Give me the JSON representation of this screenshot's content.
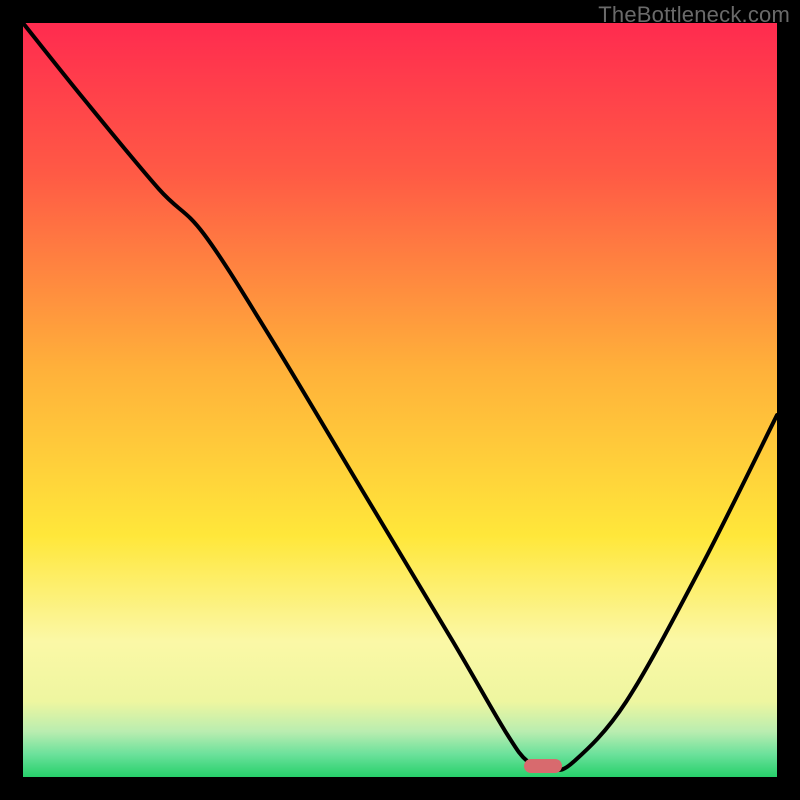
{
  "watermark": "TheBottleneck.com",
  "colors": {
    "frame": "#000000",
    "top": "#ff2b4f",
    "mid_orange": "#ff8a3a",
    "yellow": "#ffe93a",
    "pale_yellow": "#faf9b8",
    "mint": "#8ceab1",
    "green": "#26d06a",
    "curve": "#000000",
    "marker": "#d86a6e"
  },
  "chart_data": {
    "type": "line",
    "title": "",
    "xlabel": "",
    "ylabel": "",
    "xlim": [
      0,
      100
    ],
    "ylim": [
      0,
      100
    ],
    "series": [
      {
        "name": "bottleneck-curve",
        "x": [
          0,
          8,
          18,
          24,
          33,
          45,
          57,
          64,
          67,
          70,
          73,
          80,
          90,
          100
        ],
        "y": [
          100,
          90,
          78,
          72,
          58,
          38,
          18,
          6,
          2,
          1,
          2,
          10,
          28,
          48
        ]
      }
    ],
    "marker": {
      "x": 69,
      "y": 1.5
    },
    "grid": false,
    "legend": false,
    "background_gradient_stops": [
      {
        "pct": 0,
        "color": "#ff2b4f"
      },
      {
        "pct": 20,
        "color": "#ff5a45"
      },
      {
        "pct": 46,
        "color": "#ffb13a"
      },
      {
        "pct": 68,
        "color": "#ffe73a"
      },
      {
        "pct": 82,
        "color": "#fbf8a6"
      },
      {
        "pct": 90,
        "color": "#eef6a0"
      },
      {
        "pct": 94,
        "color": "#b9edb0"
      },
      {
        "pct": 97,
        "color": "#6be19b"
      },
      {
        "pct": 100,
        "color": "#26d06a"
      }
    ]
  }
}
